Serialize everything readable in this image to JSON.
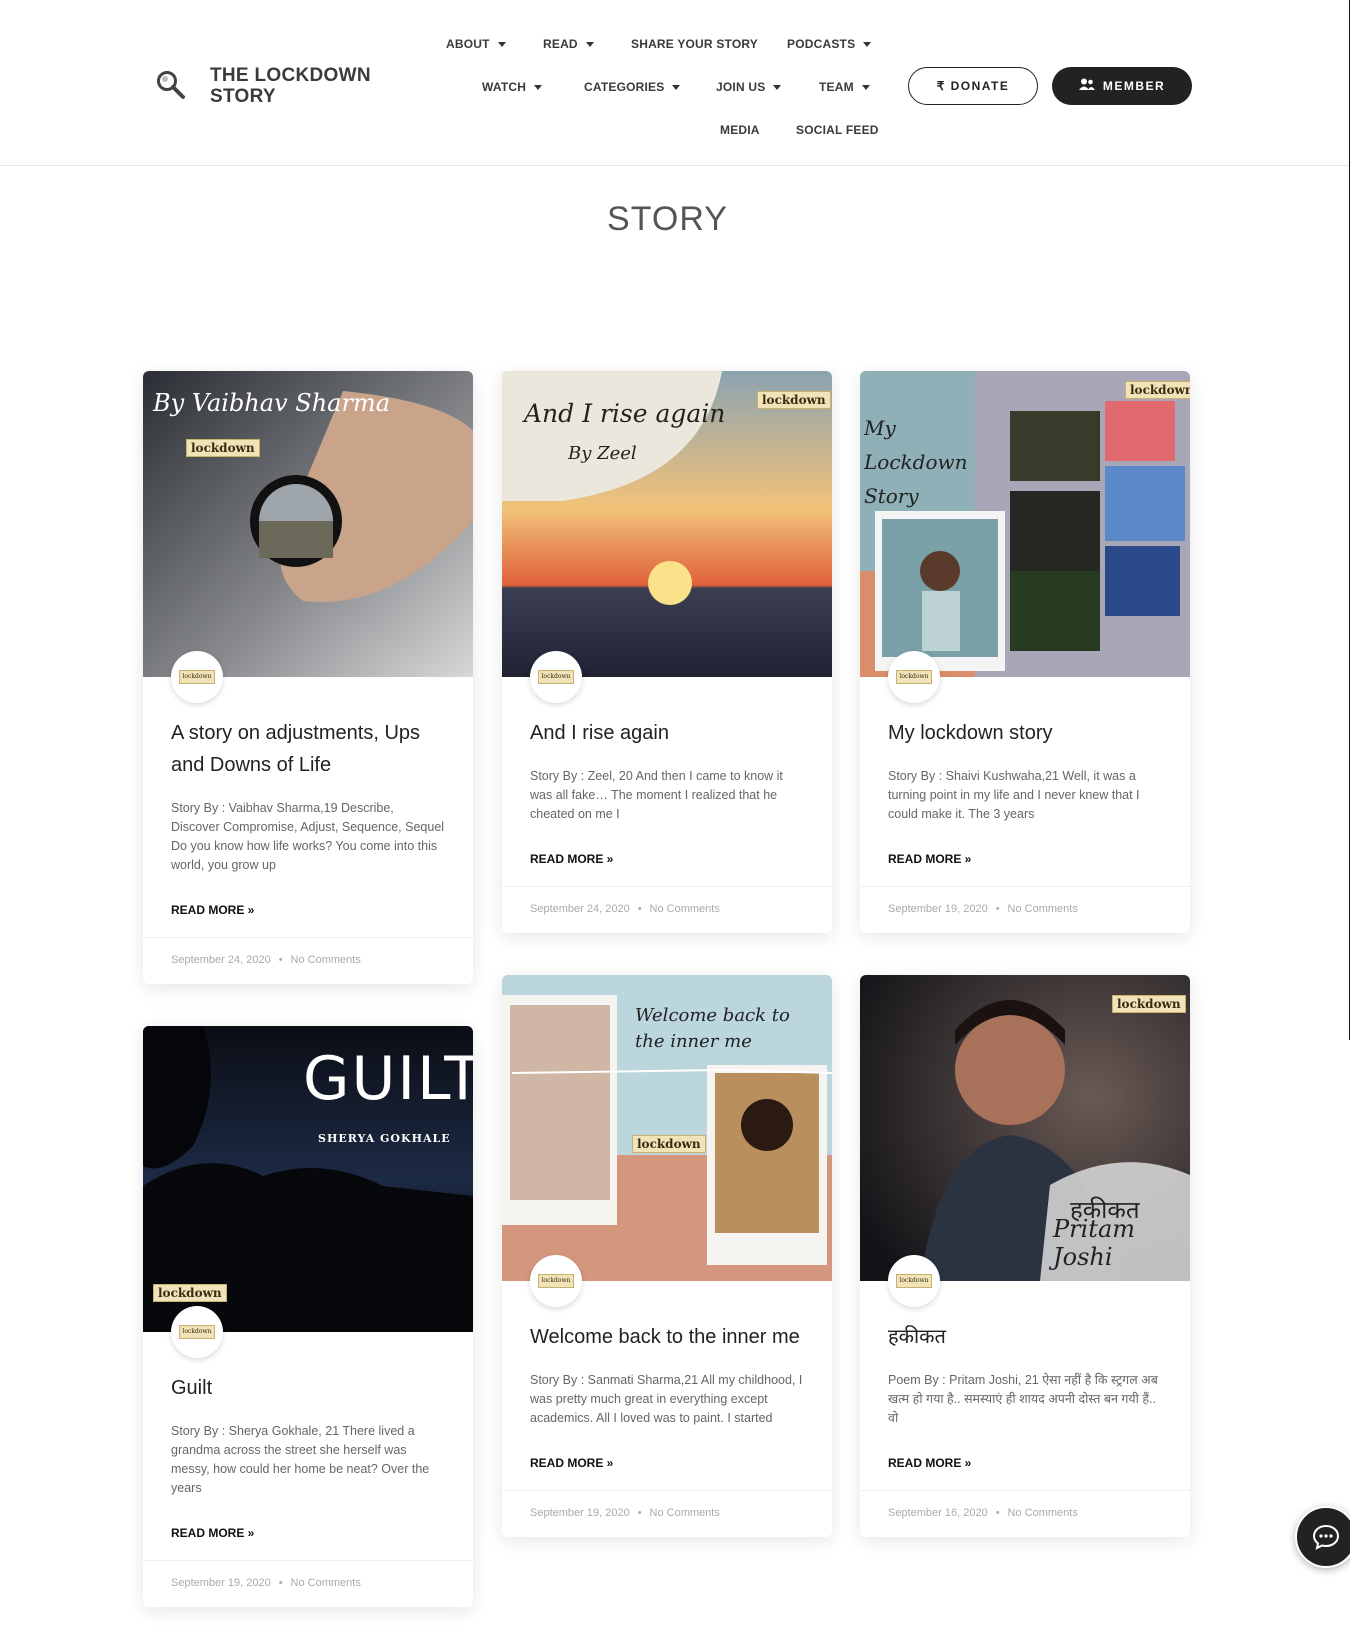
{
  "site": {
    "logo_line1": "THE LOCKDOWN",
    "logo_line2": "STORY",
    "search_icon": "search-icon"
  },
  "nav": {
    "about": "ABOUT",
    "read": "READ",
    "share": "SHARE YOUR STORY",
    "podcasts": "PODCASTS",
    "watch": "WATCH",
    "categories": "CATEGORIES",
    "joinus": "JOIN US",
    "team": "TEAM",
    "media": "MEDIA",
    "social": "SOCIAL FEED"
  },
  "buttons": {
    "donate": "₹ DONATE",
    "member": "MEMBER"
  },
  "page": {
    "title": "STORY"
  },
  "cards": [
    {
      "title": "A story on adjustments, Ups and Downs of Life",
      "excerpt": "Story By : Vaibhav Sharma,19 Describe, Discover Compromise, Adjust, Sequence, Sequel Do you know how life works? You come into this world, you grow up",
      "read_more": "READ MORE »",
      "date": "September 24, 2020",
      "comments": "No Comments",
      "caption": "By Vaibhav Sharma",
      "badge": "lockdown"
    },
    {
      "title": "And I rise again",
      "excerpt": "Story By : Zeel, 20 And then I came to know it was all fake… The moment I realized that he cheated on me I",
      "read_more": "READ MORE »",
      "date": "September 24, 2020",
      "comments": "No Comments",
      "caption": "And I rise again",
      "caption2": "By Zeel",
      "badge": "lockdown"
    },
    {
      "title": "My lockdown story",
      "excerpt": "Story By : Shaivi Kushwaha,21 Well, it was a turning point in my life and I never knew that I could make it. The 3 years",
      "read_more": "READ MORE »",
      "date": "September 19, 2020",
      "comments": "No Comments",
      "caption": "My Lockdown Story",
      "badge": "lockdown"
    },
    {
      "title": "Guilt",
      "excerpt": "Story By :  Sherya Gokhale, 21 There lived a grandma across the street she herself was messy, how could her home be neat? Over the years",
      "read_more": "READ MORE »",
      "date": "September 19, 2020",
      "comments": "No Comments",
      "caption": "GUILT",
      "caption2": "SHERYA GOKHALE",
      "badge": "lockdown"
    },
    {
      "title": "Welcome back to the inner me",
      "excerpt": " Story By : Sanmati Sharma,21 All my childhood, I was pretty much great in everything except academics. All I loved  was to paint. I started",
      "read_more": "READ MORE »",
      "date": "September 19, 2020",
      "comments": "No Comments",
      "caption": "Welcome back to the inner me",
      "badge": "lockdown"
    },
    {
      "title": "हकीकत",
      "excerpt": "Poem By : Pritam Joshi, 21 ऐसा नहीं है कि स्ट्रगल अब खत्म हो गया है.. समस्याएं ही शायद अपनी दोस्त बन गयी हैं.. वो",
      "read_more": "READ MORE »",
      "date": "September 16, 2020",
      "comments": "No Comments",
      "caption": "हकीकत",
      "caption2": "Pritam Joshi",
      "badge": "lockdown"
    }
  ],
  "chat": {
    "icon": "chat-icon"
  }
}
